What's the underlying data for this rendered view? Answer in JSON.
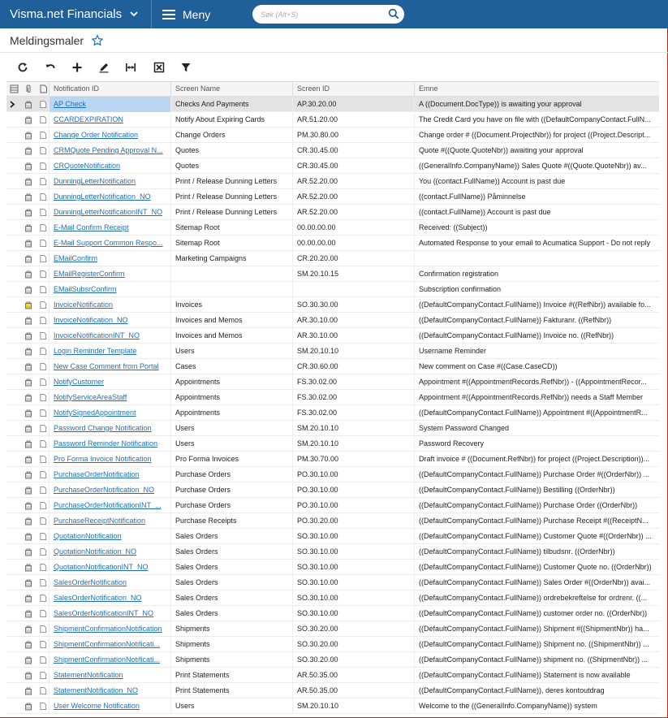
{
  "app": {
    "brand": "Visma.net Financials",
    "menu_label": "Meny",
    "search_placeholder": "Søk (Alt+S)"
  },
  "page": {
    "title": "Meldingsmaler"
  },
  "toolbar": {
    "buttons": [
      "refresh-icon",
      "undo-icon",
      "add-icon",
      "edit-icon",
      "fit-columns-icon",
      "export-excel-icon",
      "filter-icon"
    ]
  },
  "columns": {
    "notification_id": "Notification ID",
    "screen_name": "Screen Name",
    "screen_id": "Screen ID",
    "emne": "Emne"
  },
  "colors": {
    "topbar": "#1f5f9a",
    "link": "#1f6fb7",
    "selected_row": "#e3e3e3",
    "selected_cell": "#b9d7f2",
    "frame_border": "#d7191c"
  },
  "rows": [
    {
      "id": "AP Check",
      "screen": "Checks And Payments",
      "screen_id": "AP.30.20.00",
      "emne": "A ((Document.DocType)) is awaiting your approval"
    },
    {
      "id": "CCARDEXPIRATION",
      "screen": "Notify About Expiring Cards",
      "screen_id": "AR.51.20.00",
      "emne": "The Credit Card you have on file with ((DefaultCompanyContact.FullN..."
    },
    {
      "id": "Change Order Notification",
      "screen": "Change Orders",
      "screen_id": "PM.30.80.00",
      "emne": "Change order # ((Document.ProjectNbr)) for project ((Project.Descript..."
    },
    {
      "id": "CRMQuote Pending Approval N...",
      "screen": "Quotes",
      "screen_id": "CR.30.45.00",
      "emne": "Quote #((Quote.QuoteNbr)) awaiting your approval"
    },
    {
      "id": "CRQuoteNotification",
      "screen": "Quotes",
      "screen_id": "CR.30.45.00",
      "emne": "((GeneralInfo.CompanyName)) Sales Quote #((Quote.QuoteNbr)) av..."
    },
    {
      "id": "DunningLetterNotification",
      "screen": "Print / Release Dunning Letters",
      "screen_id": "AR.52.20.00",
      "emne": "You ((contact.FullName)) Account is past due"
    },
    {
      "id": "DunningLetterNotification_NO",
      "screen": "Print / Release Dunning Letters",
      "screen_id": "AR.52.20.00",
      "emne": "((contact.FullName)) Påminnelse"
    },
    {
      "id": "DunningLetterNotificationINT_NO",
      "screen": "Print / Release Dunning Letters",
      "screen_id": "AR.52.20.00",
      "emne": "((contact.FullName)) Account is past due"
    },
    {
      "id": "E-Mail Confirm Receipt",
      "screen": "Sitemap Root",
      "screen_id": "00.00.00.00",
      "emne": "Received: ((Subject))"
    },
    {
      "id": "E-Mail Support Common Respo...",
      "screen": "Sitemap Root",
      "screen_id": "00.00.00.00",
      "emne": "Automated Response to your email to Acumatica Support - Do not reply"
    },
    {
      "id": "EMailConfirm",
      "screen": "Marketing Campaigns",
      "screen_id": "CR.20.20.00",
      "emne": ""
    },
    {
      "id": "EMailRegisterConfirm",
      "screen": "",
      "screen_id": "SM.20.10.15",
      "emne": "Confirmation registration"
    },
    {
      "id": "EMailSubsrConfirm",
      "screen": "",
      "screen_id": "",
      "emne": "Subscription confirmation"
    },
    {
      "id": "InvoiceNotification",
      "screen": "Invoices",
      "screen_id": "SO.30.30.00",
      "emne": "((DefaultCompanyContact.FullName)) Invoice #((RefNbr)) available fo...",
      "attach": true
    },
    {
      "id": "InvoiceNotification_NO",
      "screen": "Invoices and Memos",
      "screen_id": "AR.30.10.00",
      "emne": "((DefaultCompanyContact.FullName)) Fakturanr. ((RefNbr))"
    },
    {
      "id": "InvoiceNotificationINT_NO",
      "screen": "Invoices and Memos",
      "screen_id": "AR.30.10.00",
      "emne": "((DefaultCompanyContact.FullName)) Invoice no. ((RefNbr))"
    },
    {
      "id": "Login Reminder Template",
      "screen": "Users",
      "screen_id": "SM.20.10.10",
      "emne": "Username Reminder"
    },
    {
      "id": "New Case Comment from Portal",
      "screen": "Cases",
      "screen_id": "CR.30.60.00",
      "emne": "New comment on Case #((Case.CaseCD))"
    },
    {
      "id": "NotifyCustomer",
      "screen": "Appointments",
      "screen_id": "FS.30.02.00",
      "emne": "Appointment #((AppointmentRecords.RefNbr)) - ((AppointmentRecor..."
    },
    {
      "id": "NotifyServiceAreaStaff",
      "screen": "Appointments",
      "screen_id": "FS.30.02.00",
      "emne": "Appointment #((AppointmentRecords.RefNbr)) needs a Staff Member"
    },
    {
      "id": "NotifySignedAppointment",
      "screen": "Appointments",
      "screen_id": "FS.30.02.00",
      "emne": "((DefaultCompanyContact.FullName)) Appointment #((AppointmentR..."
    },
    {
      "id": "Password Change Notification",
      "screen": "Users",
      "screen_id": "SM.20.10.10",
      "emne": "System Password Changed"
    },
    {
      "id": "Password Reminder Notification",
      "screen": "Users",
      "screen_id": "SM.20.10.10",
      "emne": "Password Recovery"
    },
    {
      "id": "Pro Forma Invoice Notification",
      "screen": "Pro Forma Invoices",
      "screen_id": "PM.30.70.00",
      "emne": "Draft invoice # ((Document.RefNbr)) for project ((Project.Description))..."
    },
    {
      "id": "PurchaseOrderNotification",
      "screen": "Purchase Orders",
      "screen_id": "PO.30.10.00",
      "emne": "((DefaultCompanyContact.FullName)) Purchase Order #((OrderNbr)) ..."
    },
    {
      "id": "PurchaseOrderNotification_NO",
      "screen": "Purchase Orders",
      "screen_id": "PO.30.10.00",
      "emne": "((DefaultCompanyContact.FullName)) Bestilling ((OrderNbr))"
    },
    {
      "id": "PurchaseOrderNotificationINT_...",
      "screen": "Purchase Orders",
      "screen_id": "PO.30.10.00",
      "emne": "((DefaultCompanyContact.FullName)) Purchase Order ((OrderNbr))"
    },
    {
      "id": "PurchaseReceiptNotification",
      "screen": "Purchase Receipts",
      "screen_id": "PO.30.20.00",
      "emne": "((DefaultCompanyContact.FullName)) Purchase Receipt #((ReceiptN..."
    },
    {
      "id": "QuotationNotification",
      "screen": "Sales Orders",
      "screen_id": "SO.30.10.00",
      "emne": "((DefaultCompanyContact.FullName)) Customer Quote #((OrderNbr)) ..."
    },
    {
      "id": "QuotationNotification_NO",
      "screen": "Sales Orders",
      "screen_id": "SO.30.10.00",
      "emne": "((DefaultCompanyContact.FullName)) tilbudsnr. ((OrderNbr))"
    },
    {
      "id": "QuotationNotificationINT_NO",
      "screen": "Sales Orders",
      "screen_id": "SO.30.10.00",
      "emne": "((DefaultCompanyContact.FullName)) Customer Quote no. ((OrderNbr))"
    },
    {
      "id": "SalesOrderNotification",
      "screen": "Sales Orders",
      "screen_id": "SO.30.10.00",
      "emne": "((DefaultCompanyContact.FullName)) Sales Order #((OrderNbr)) avai..."
    },
    {
      "id": "SalesOrderNotification_NO",
      "screen": "Sales Orders",
      "screen_id": "SO.30.10.00",
      "emne": "((DefaultCompanyContact.FullName)) ordrebekreftelse for ordrenr. ((..."
    },
    {
      "id": "SalesOrderNotificationINT_NO",
      "screen": "Sales Orders",
      "screen_id": "SO.30.10.00",
      "emne": "((DefaultCompanyContact.FullName)) customer order no. ((OrderNbr))"
    },
    {
      "id": "ShipmentConfirmationNotification",
      "screen": "Shipments",
      "screen_id": "SO.30.20.00",
      "emne": "((DefaultCompanyContact.FullName)) Shipment #((ShipmentNbr)) ha..."
    },
    {
      "id": "ShipmentConfirmationNotificati...",
      "screen": "Shipments",
      "screen_id": "SO.30.20.00",
      "emne": "((DefaultCompanyContact.FullName)) Shipment no. ((ShipmentNbr)) ..."
    },
    {
      "id": "ShipmentConfirmationNotificati...",
      "screen": "Shipments",
      "screen_id": "SO.30.20.00",
      "emne": "((DefaultCompanyContact.FullName)) shipment no. ((ShipmentNbr)) ..."
    },
    {
      "id": "StatementNotification",
      "screen": "Print Statements",
      "screen_id": "AR.50.35.00",
      "emne": "((DefaultCompanyContact.FullName)) Statement is now available"
    },
    {
      "id": "StatementNotification_NO",
      "screen": "Print Statements",
      "screen_id": "AR.50.35.00",
      "emne": "((DefaultCompanyContact.FullName)), deres kontoutdrag"
    },
    {
      "id": "User Welcome Notification",
      "screen": "Users",
      "screen_id": "SM.20.10.10",
      "emne": "Welcome to the ((GeneralInfo.CompanyName)) system"
    }
  ]
}
